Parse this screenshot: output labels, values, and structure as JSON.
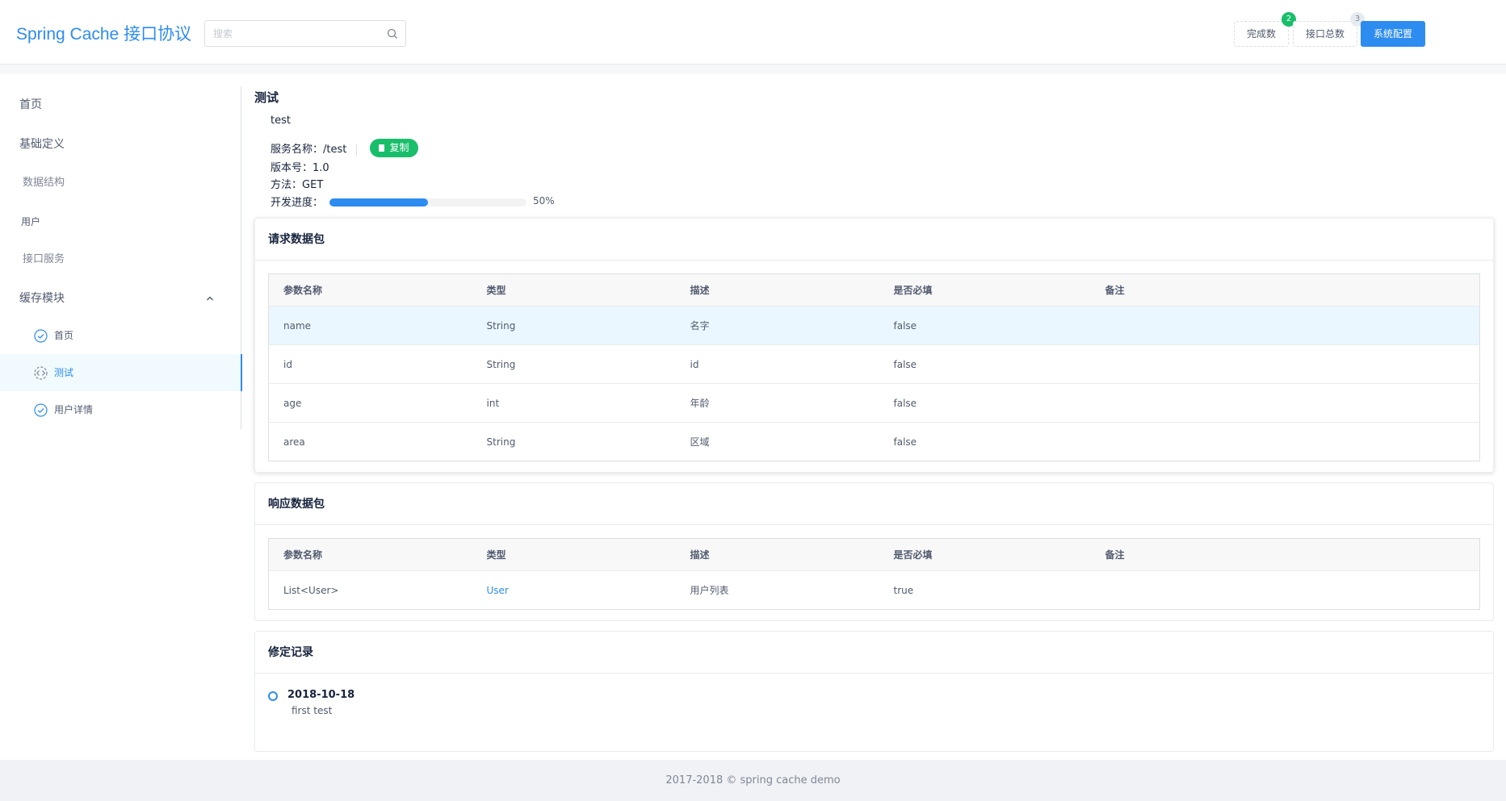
{
  "header": {
    "logo": "Spring Cache 接口协议",
    "search_placeholder": "搜索",
    "done_label": "完成数",
    "done_badge": "2",
    "total_label": "接口总数",
    "total_badge": "3",
    "config_label": "系统配置",
    "colors": {
      "accent": "#2d8cf0",
      "success": "#19be6b"
    }
  },
  "sidebar": {
    "home": "首页",
    "basic": "基础定义",
    "data_structure": "数据结构",
    "user": "用户",
    "service": "接口服务",
    "cache_module": "缓存模块",
    "sub": [
      {
        "label": "首页",
        "icon": "check-circle-icon"
      },
      {
        "label": "测试",
        "icon": "code-icon",
        "active": true
      },
      {
        "label": "用户详情",
        "icon": "check-circle-icon"
      }
    ]
  },
  "main": {
    "title": "测试",
    "subtitle": "test",
    "service_label": "服务名称",
    "service_value": "/test",
    "copy_label": "复制",
    "version_label": "版本号",
    "version_value": "1.0",
    "method_label": "方法",
    "method_value": "GET",
    "progress_label": "开发进度",
    "progress_value": 50,
    "progress_text": "50%"
  },
  "request": {
    "title": "请求数据包",
    "columns": [
      "参数名称",
      "类型",
      "描述",
      "是否必填",
      "备注"
    ],
    "rows": [
      [
        "name",
        "String",
        "名字",
        "false",
        ""
      ],
      [
        "id",
        "String",
        "id",
        "false",
        ""
      ],
      [
        "age",
        "int",
        "年龄",
        "false",
        ""
      ],
      [
        "area",
        "String",
        "区域",
        "false",
        ""
      ]
    ]
  },
  "response": {
    "title": "响应数据包",
    "columns": [
      "参数名称",
      "类型",
      "描述",
      "是否必填",
      "备注"
    ],
    "rows": [
      [
        "List<User>",
        "User",
        "用户列表",
        "true",
        ""
      ]
    ]
  },
  "log": {
    "title": "修定记录",
    "entries": [
      {
        "date": "2018-10-18",
        "desc": "first test"
      }
    ]
  },
  "footer": "2017-2018 © spring cache demo"
}
